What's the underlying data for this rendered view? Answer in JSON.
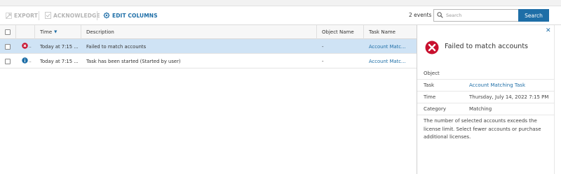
{
  "toolbar": {
    "export_label": "EXPORT",
    "acknowledge_label": "ACKNOWLEDGE",
    "edit_columns_label": "EDIT COLUMNS",
    "events_count": "2 events",
    "search_placeholder": "Search",
    "search_button": "Search"
  },
  "grid": {
    "columns": [
      "Time",
      "Description",
      "Object Name",
      "Task Name"
    ],
    "time_sort_indicator": "▼",
    "rows": [
      {
        "status": "error",
        "time": "Today at 7:15 ...",
        "description": "Failed to match accounts",
        "object_name": "-",
        "task_name": "Account Matc...",
        "selected": true
      },
      {
        "status": "info",
        "time": "Today at 7:15 ...",
        "description": "Task has been started (Started by user)",
        "object_name": "-",
        "task_name": "Account Matc...",
        "selected": false
      }
    ]
  },
  "detail": {
    "title": "Failed to match accounts",
    "close_icon": "close-icon",
    "fields": [
      {
        "label": "Object",
        "value": ""
      },
      {
        "label": "Task",
        "value": "Account Matching Task",
        "link": true
      },
      {
        "label": "Time",
        "value": "Thursday, July 14, 2022 7:15 PM"
      },
      {
        "label": "Category",
        "value": "Matching"
      }
    ],
    "message": "The number of selected accounts exceeds the license limit. Select fewer accounts or purchase additional licenses."
  },
  "colors": {
    "accent": "#1e6ea7",
    "selected_row": "#cfe3f5",
    "error": "#c8102e",
    "info": "#1e6ea7"
  }
}
